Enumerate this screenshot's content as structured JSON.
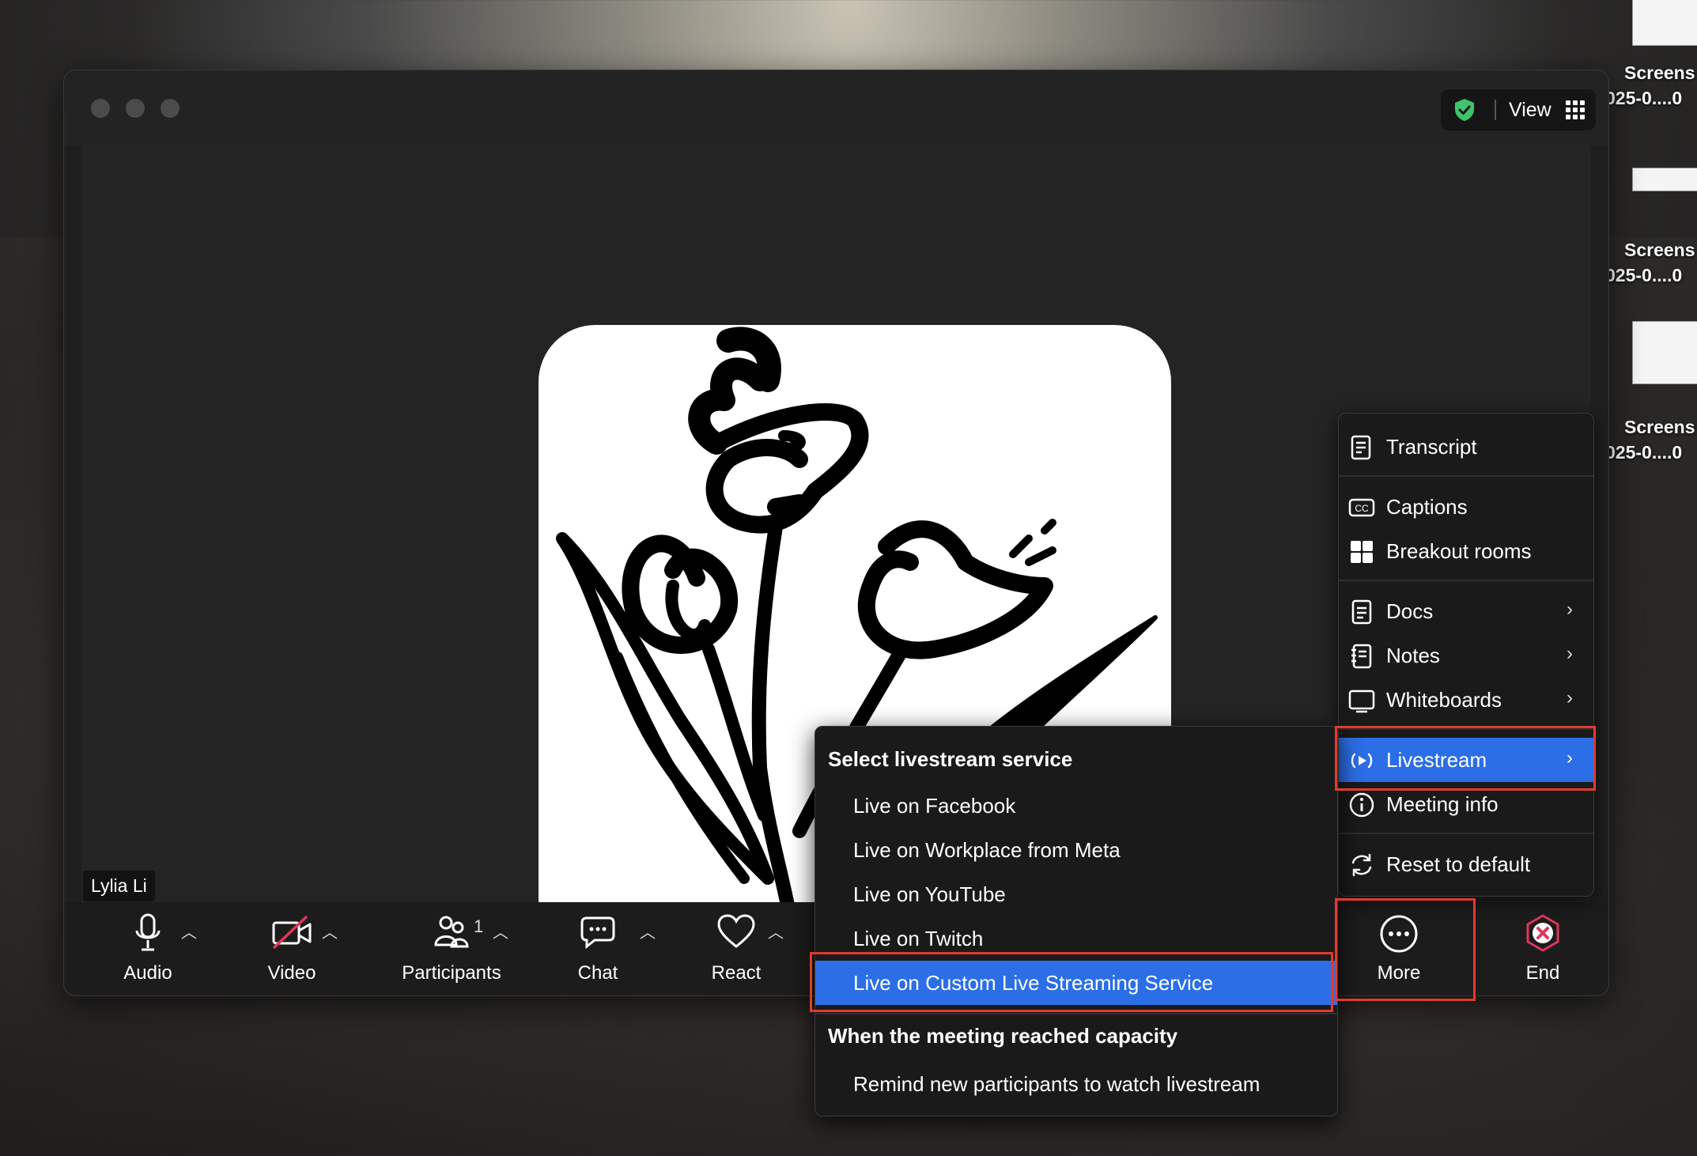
{
  "desktop": {
    "icons": [
      {
        "label_line1": "Screens",
        "label_line2": "025-0....0"
      },
      {
        "label_line1": "Screens",
        "label_line2": "025-0....0"
      },
      {
        "label_line1": "Screens",
        "label_line2": "025-0....0"
      }
    ]
  },
  "window": {
    "top_right": {
      "view_label": "View",
      "security_icon": "shield-check-icon",
      "grid_icon": "grid-icon"
    },
    "participant_name": "Lylia Li"
  },
  "toolbar": {
    "audio": "Audio",
    "video": "Video",
    "participants": "Participants",
    "participants_count": "1",
    "chat": "Chat",
    "react": "React",
    "more": "More",
    "end": "End"
  },
  "more_menu": {
    "items": [
      {
        "label": "Transcript",
        "icon": "transcript-icon"
      },
      {
        "label": "Captions",
        "icon": "captions-icon"
      },
      {
        "label": "Breakout rooms",
        "icon": "breakout-rooms-icon"
      },
      {
        "label": "Docs",
        "icon": "docs-icon"
      },
      {
        "label": "Notes",
        "icon": "notes-icon"
      },
      {
        "label": "Whiteboards",
        "icon": "whiteboards-icon"
      },
      {
        "label": "Livestream",
        "icon": "livestream-icon"
      },
      {
        "label": "Meeting info",
        "icon": "info-icon"
      },
      {
        "label": "Reset to default",
        "icon": "reset-icon"
      }
    ]
  },
  "livestream_menu": {
    "heading1": "Select livestream service",
    "options": [
      "Live on Facebook",
      "Live on Workplace from Meta",
      "Live on YouTube",
      "Live on Twitch",
      "Live on Custom Live Streaming Service"
    ],
    "heading2": "When the meeting reached capacity",
    "capacity_option": "Remind new participants to watch livestream"
  },
  "colors": {
    "accent": "#2b6ee6",
    "highlight": "#e03b2d",
    "end_red": "#e0365a",
    "shield_green": "#3ec46d"
  }
}
